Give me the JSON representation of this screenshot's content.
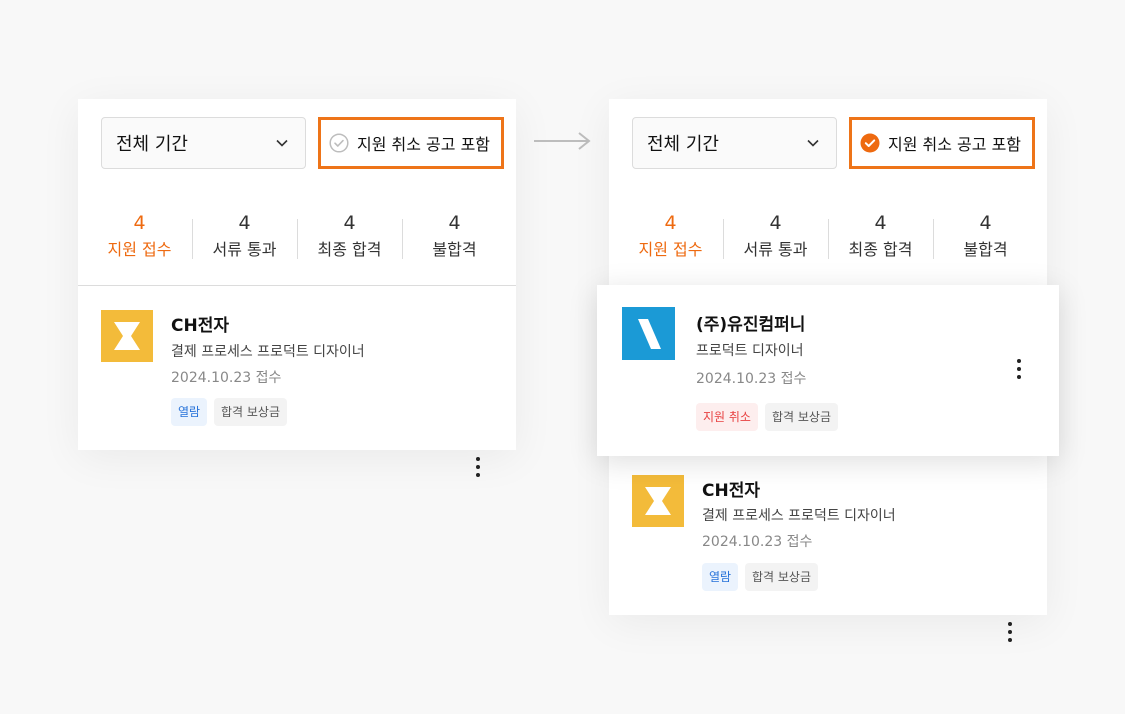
{
  "filter": {
    "period_label": "전체 기간",
    "include_cancelled_label": "지원 취소 공고 포함"
  },
  "stats": [
    {
      "count": "4",
      "label": "지원 접수"
    },
    {
      "count": "4",
      "label": "서류 통과"
    },
    {
      "count": "4",
      "label": "최종 합격"
    },
    {
      "count": "4",
      "label": "불합격"
    }
  ],
  "before": {
    "include_cancelled_checked": false,
    "applications": [
      {
        "company": "CH전자",
        "position": "결제 프로세스 프로덕트 디자이너",
        "date": "2024.10.23 접수",
        "tags": [
          "열람",
          "합격 보상금"
        ],
        "logo": "ch-logo-icon"
      }
    ]
  },
  "after": {
    "include_cancelled_checked": true,
    "applications": [
      {
        "company": "(주)유진컴퍼니",
        "position": "프로덕트 디자이너",
        "date": "2024.10.23 접수",
        "tags": [
          "지원 취소",
          "합격 보상금"
        ],
        "logo": "yujin-logo-icon"
      },
      {
        "company": "CH전자",
        "position": "결제 프로세스 프로덕트 디자이너",
        "date": "2024.10.23 접수",
        "tags": [
          "열람",
          "합격 보상금"
        ],
        "logo": "ch-logo-icon"
      }
    ]
  },
  "colors": {
    "accent": "#ee7418",
    "active_stat": "#ee6a10",
    "viewed_tag_text": "#2672d9",
    "cancelled_tag_text": "#e84141",
    "ch_logo_yellow": "#f3bb3a",
    "yujin_logo_blue": "#1b9ad6"
  }
}
